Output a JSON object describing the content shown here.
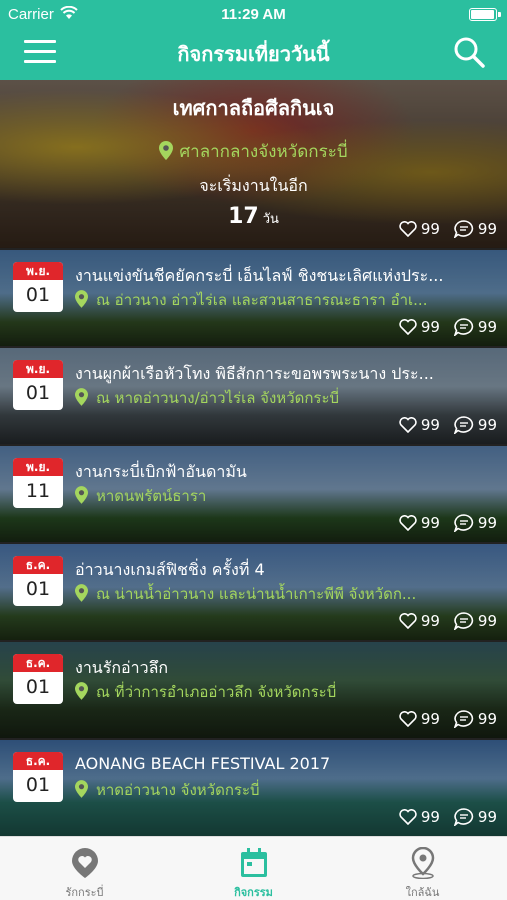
{
  "status": {
    "carrier": "Carrier",
    "time": "11:29 AM",
    "battery": 1.0
  },
  "header": {
    "title": "กิจกรรมเที่ยววันนี้"
  },
  "hero": {
    "title": "เทศกาลถือศีลกินเจ",
    "location": "ศาลากลางจังหวัดกระบี่",
    "starts_text": "จะเริ่มงานในอีก",
    "days": "17",
    "days_unit": "วัน",
    "likes": "99",
    "comments": "99"
  },
  "events": [
    {
      "month": "พ.ย.",
      "day": "01",
      "title": "งานแข่งขันชีคยัคกระบี่ เอ็นไลฟ์ ชิงชนะเลิศแห่งประ...",
      "location": "ณ อ่าวนาง อ่าวไร่เล และสวนสาธารณะธารา อำเ...",
      "likes": "99",
      "comments": "99"
    },
    {
      "month": "พ.ย.",
      "day": "01",
      "title": "งานผูกผ้าเรือหัวโทง พิธีสักการะขอพรพระนาง ประ...",
      "location": "ณ หาดอ่าวนาง/อ่าวไร่เล จังหวัดกระบี่",
      "likes": "99",
      "comments": "99"
    },
    {
      "month": "พ.ย.",
      "day": "11",
      "title": "งานกระบี่เบิกฟ้าอันดามัน",
      "location": "หาดนพรัตน์ธารา",
      "likes": "99",
      "comments": "99"
    },
    {
      "month": "ธ.ค.",
      "day": "01",
      "title": "อ่าวนางเกมส์ฟิชชิ่ง ครั้งที่ 4",
      "location": "ณ น่านน้ำอ่าวนาง และน่านน้ำเกาะพีพี จังหวัดก...",
      "likes": "99",
      "comments": "99"
    },
    {
      "month": "ธ.ค.",
      "day": "01",
      "title": "งานรักอ่าวลึก",
      "location": "ณ ที่ว่าการอำเภออ่าวลึก จังหวัดกระบี่",
      "likes": "99",
      "comments": "99"
    },
    {
      "month": "ธ.ค.",
      "day": "01",
      "title": "AONANG BEACH FESTIVAL 2017",
      "location": "หาดอ่าวนาง จังหวัดกระบี่",
      "likes": "99",
      "comments": "99"
    }
  ],
  "tabs": [
    {
      "label": "รักกระบี่",
      "icon": "heart-pin-icon"
    },
    {
      "label": "กิจกรรม",
      "icon": "calendar-icon"
    },
    {
      "label": "ใกล้ฉัน",
      "icon": "location-pin-icon"
    }
  ],
  "colors": {
    "accent": "#2bbf9f",
    "location": "#a4d65e",
    "calendar_red": "#e0262b"
  }
}
